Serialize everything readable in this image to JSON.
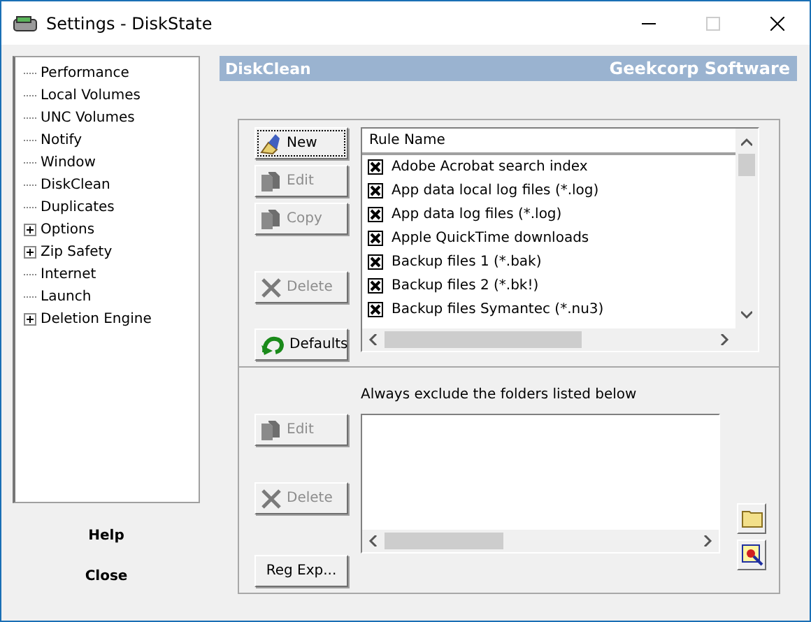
{
  "window": {
    "title": "Settings - DiskState",
    "maximize_disabled": true
  },
  "sidebar": {
    "items": [
      {
        "label": "Performance",
        "expandable": false
      },
      {
        "label": "Local Volumes",
        "expandable": false
      },
      {
        "label": "UNC Volumes",
        "expandable": false
      },
      {
        "label": "Notify",
        "expandable": false
      },
      {
        "label": "Window",
        "expandable": false
      },
      {
        "label": "DiskClean",
        "expandable": false
      },
      {
        "label": "Duplicates",
        "expandable": false
      },
      {
        "label": "Options",
        "expandable": true
      },
      {
        "label": "Zip Safety",
        "expandable": true
      },
      {
        "label": "Internet",
        "expandable": false
      },
      {
        "label": "Launch",
        "expandable": false
      },
      {
        "label": "Deletion Engine",
        "expandable": true
      }
    ],
    "buttons": [
      "Help",
      "Close"
    ]
  },
  "header": {
    "title": "DiskClean",
    "brand": "Geekcorp Software"
  },
  "rule_buttons": [
    {
      "kind": "new",
      "label": "New",
      "disabled": false
    },
    {
      "kind": "edit",
      "label": "Edit",
      "disabled": true
    },
    {
      "kind": "copy",
      "label": "Copy",
      "disabled": true
    },
    {
      "kind": "delete",
      "label": "Delete",
      "disabled": true
    },
    {
      "kind": "defaults",
      "label": "Defaults",
      "disabled": false
    }
  ],
  "rules": {
    "column": "Rule Name",
    "rows": [
      {
        "name": "Adobe Acrobat search index",
        "checked": true
      },
      {
        "name": "App data local log files (*.log)",
        "checked": true
      },
      {
        "name": "App data log files (*.log)",
        "checked": true
      },
      {
        "name": "Apple QuickTime downloads",
        "checked": true
      },
      {
        "name": "Backup files 1 (*.bak)",
        "checked": true
      },
      {
        "name": "Backup files 2 (*.bk!)",
        "checked": true
      },
      {
        "name": "Backup files Symantec (*.nu3)",
        "checked": true
      }
    ]
  },
  "exclude": {
    "label": "Always exclude the folders listed below",
    "buttons": [
      {
        "kind": "edit",
        "label": "Edit",
        "disabled": true
      },
      {
        "kind": "delete",
        "label": "Delete",
        "disabled": true
      },
      {
        "kind": "regex",
        "label": "Reg Exp...",
        "disabled": false
      }
    ]
  }
}
